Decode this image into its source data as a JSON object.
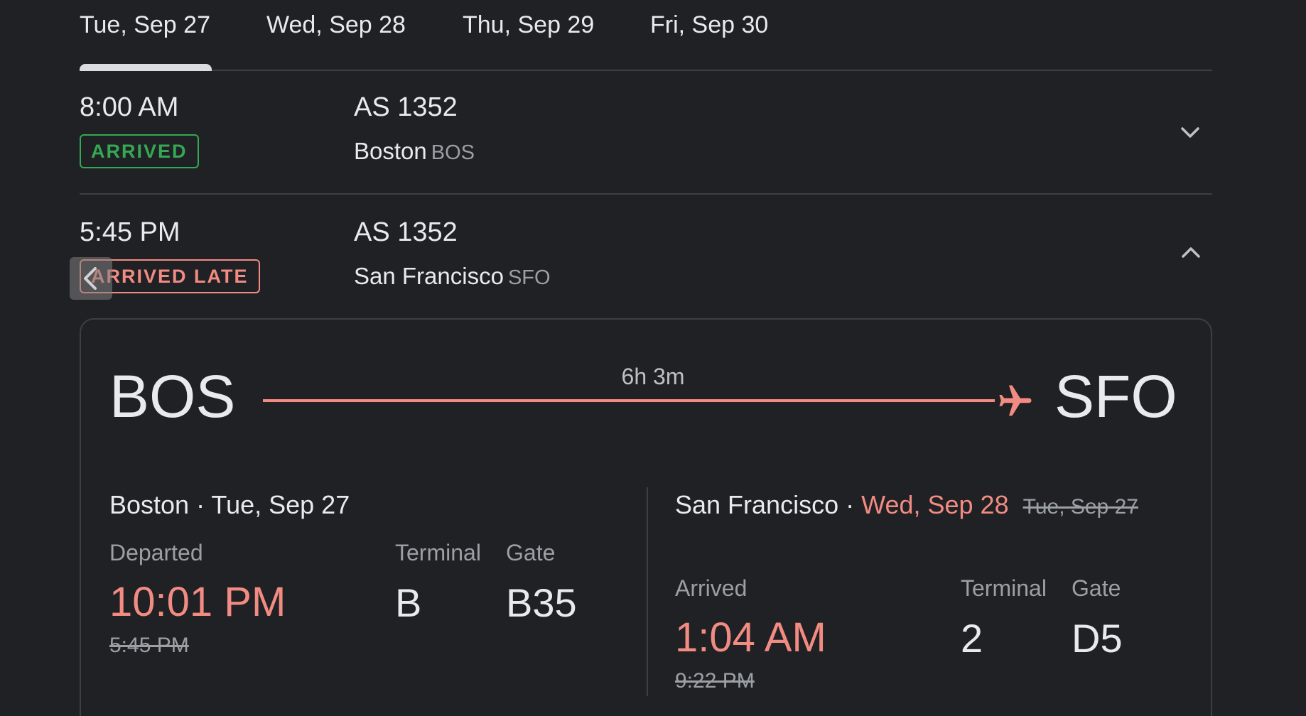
{
  "tabs": [
    {
      "label": "Tue, Sep 27",
      "selected": true
    },
    {
      "label": "Wed, Sep 28",
      "selected": false
    },
    {
      "label": "Thu, Sep 29",
      "selected": false
    },
    {
      "label": "Fri, Sep 30",
      "selected": false
    }
  ],
  "flights": [
    {
      "time": "8:00 AM",
      "status": "ARRIVED",
      "flight_number": "AS 1352",
      "city": "Boston",
      "code": "BOS",
      "expanded": false
    },
    {
      "time": "5:45 PM",
      "status": "ARRIVED LATE",
      "flight_number": "AS 1352",
      "city": "San Francisco",
      "code": "SFO",
      "expanded": true
    }
  ],
  "details": {
    "origin_code": "BOS",
    "destination_code": "SFO",
    "duration": "6h 3m",
    "departure": {
      "city": "Boston",
      "date": "Tue, Sep 27",
      "label": "Departed",
      "time": "10:01 PM",
      "scheduled": "5:45 PM",
      "terminal_label": "Terminal",
      "terminal": "B",
      "gate_label": "Gate",
      "gate": "B35"
    },
    "arrival": {
      "city": "San Francisco",
      "date": "Wed, Sep 28",
      "original_date": "Tue, Sep 27",
      "label": "Arrived",
      "time": "1:04 AM",
      "scheduled": "9:22 PM",
      "terminal_label": "Terminal",
      "terminal": "2",
      "gate_label": "Gate",
      "gate": "D5"
    }
  },
  "colors": {
    "background": "#202124",
    "on_time": "#34a853",
    "late": "#f28b82",
    "muted": "#9aa0a6",
    "text": "#e8eaed"
  },
  "icons": {
    "collapsed": "chevron-down-icon",
    "expanded": "chevron-up-icon",
    "route": "airplane-icon",
    "back": "chevron-left-icon"
  }
}
